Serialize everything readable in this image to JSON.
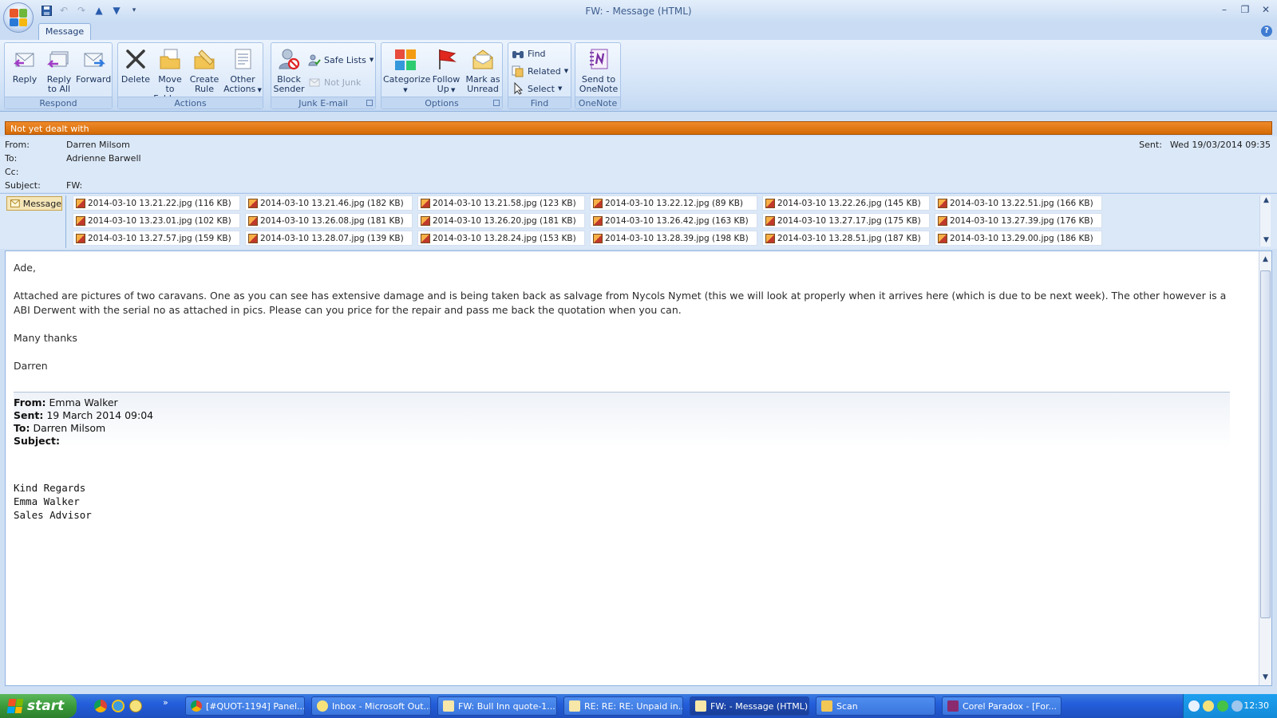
{
  "window": {
    "title": "FW:  - Message (HTML)"
  },
  "tabs": [
    {
      "label": "Message"
    }
  ],
  "ribbon": {
    "groups": [
      {
        "label": "Respond"
      },
      {
        "label": "Actions"
      },
      {
        "label": "Junk E-mail"
      },
      {
        "label": "Options"
      },
      {
        "label": "Find"
      },
      {
        "label": "OneNote"
      }
    ],
    "reply": "Reply",
    "reply_all_1": "Reply",
    "reply_all_2": "to All",
    "forward": "Forward",
    "delete": "Delete",
    "move_1": "Move to",
    "move_2": "Folder",
    "create_1": "Create",
    "create_2": "Rule",
    "other_1": "Other",
    "other_2": "Actions",
    "block_1": "Block",
    "block_2": "Sender",
    "safe_lists": "Safe Lists",
    "not_junk": "Not Junk",
    "categorize": "Categorize",
    "follow_1": "Follow",
    "follow_2": "Up",
    "mark_1": "Mark as",
    "mark_2": "Unread",
    "find": "Find",
    "related": "Related",
    "select": "Select",
    "onenote_1": "Send to",
    "onenote_2": "OneNote"
  },
  "infobar": "Not yet dealt with",
  "header": {
    "from_label": "From:",
    "from": "Darren Milsom",
    "to_label": "To:",
    "to": "Adrienne Barwell",
    "cc_label": "Cc:",
    "subject_label": "Subject:",
    "subject": "FW:",
    "sent_label": "Sent:",
    "sent": "Wed 19/03/2014 09:35"
  },
  "message_tab": "Message",
  "attachments": [
    "2014-03-10 13.21.22.jpg (116 KB)",
    "2014-03-10 13.21.46.jpg (182 KB)",
    "2014-03-10 13.21.58.jpg (123 KB)",
    "2014-03-10 13.22.12.jpg (89 KB)",
    "2014-03-10 13.22.26.jpg (145 KB)",
    "2014-03-10 13.22.51.jpg (166 KB)",
    "2014-03-10 13.23.01.jpg (102 KB)",
    "2014-03-10 13.26.08.jpg (181 KB)",
    "2014-03-10 13.26.20.jpg (181 KB)",
    "2014-03-10 13.26.42.jpg (163 KB)",
    "2014-03-10 13.27.17.jpg (175 KB)",
    "2014-03-10 13.27.39.jpg (176 KB)",
    "2014-03-10 13.27.57.jpg (159 KB)",
    "2014-03-10 13.28.07.jpg (139 KB)",
    "2014-03-10 13.28.24.jpg (153 KB)",
    "2014-03-10 13.28.39.jpg (198 KB)",
    "2014-03-10 13.28.51.jpg (187 KB)",
    "2014-03-10 13.29.00.jpg (186 KB)"
  ],
  "body": {
    "greeting": "Ade,",
    "paragraph": "Attached are pictures of two caravans. One as you can see has extensive damage and is being taken back as salvage from Nycols Nymet (this we will look at properly when it arrives here (which is due to be next week). The other however is a ABI Derwent with the serial no as attached in pics. Please can you price for the repair and pass me back the quotation when you can.",
    "thanks": "Many thanks",
    "signoff": "Darren",
    "fwd_from_label": "From:",
    "fwd_from": "Emma Walker",
    "fwd_sent_label": "Sent:",
    "fwd_sent": "19 March 2014 09:04",
    "fwd_to_label": "To:",
    "fwd_to": "Darren Milsom",
    "fwd_subject_label": "Subject:",
    "sig_1": "Kind Regards",
    "sig_2": "Emma Walker",
    "sig_3": "Sales Advisor"
  },
  "taskbar": {
    "start": "start",
    "tasks": [
      "[#QUOT-1194] Panel...",
      "Inbox - Microsoft Out...",
      "FW: Bull Inn  quote-1...",
      "RE: RE: RE: Unpaid in...",
      "FW:  - Message (HTML)",
      "Scan",
      "Corel Paradox - [For..."
    ],
    "clock": "12:30"
  },
  "colors": {
    "infobar": "#e27312",
    "ribbon": "#dce9f9",
    "taskbar": "#245edb",
    "start": "#3a9a3a"
  }
}
